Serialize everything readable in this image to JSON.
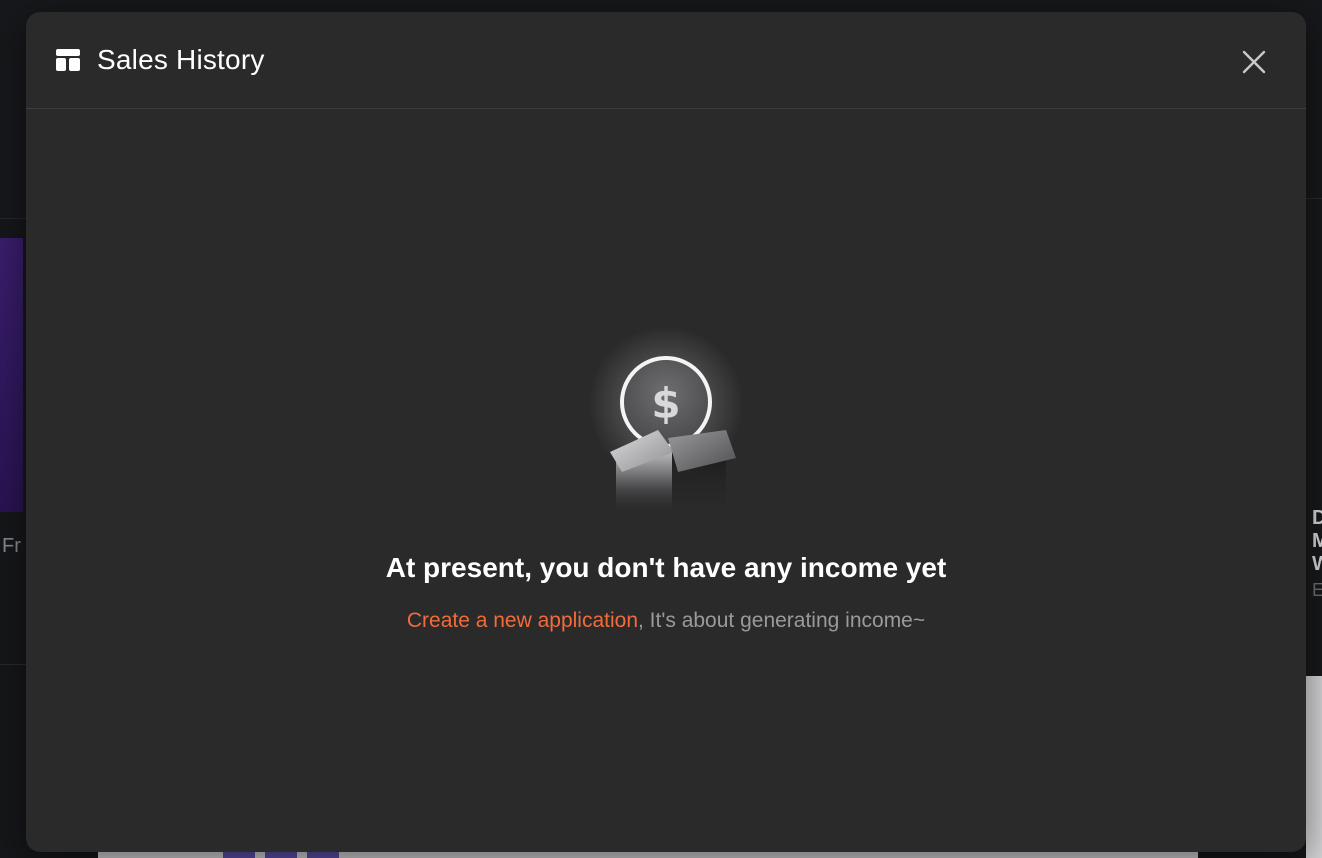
{
  "modal": {
    "title": "Sales History",
    "header_icon": "layout-icon",
    "close_icon": "close-icon"
  },
  "empty_state": {
    "illustration_icon": "coin-in-box-icon",
    "coin_symbol": "$",
    "heading": "At present, you don't have any income yet",
    "link_text": "Create a new application",
    "rest_text": ", It's about generating income~"
  },
  "background": {
    "left_card_text": "Fr",
    "right_card_title_lines": [
      "D",
      "M",
      "W"
    ],
    "right_card_sub": "E"
  },
  "colors": {
    "modal_bg": "#2a2a2b",
    "accent": "#f26b3a",
    "muted_text": "#9a9a9d"
  }
}
